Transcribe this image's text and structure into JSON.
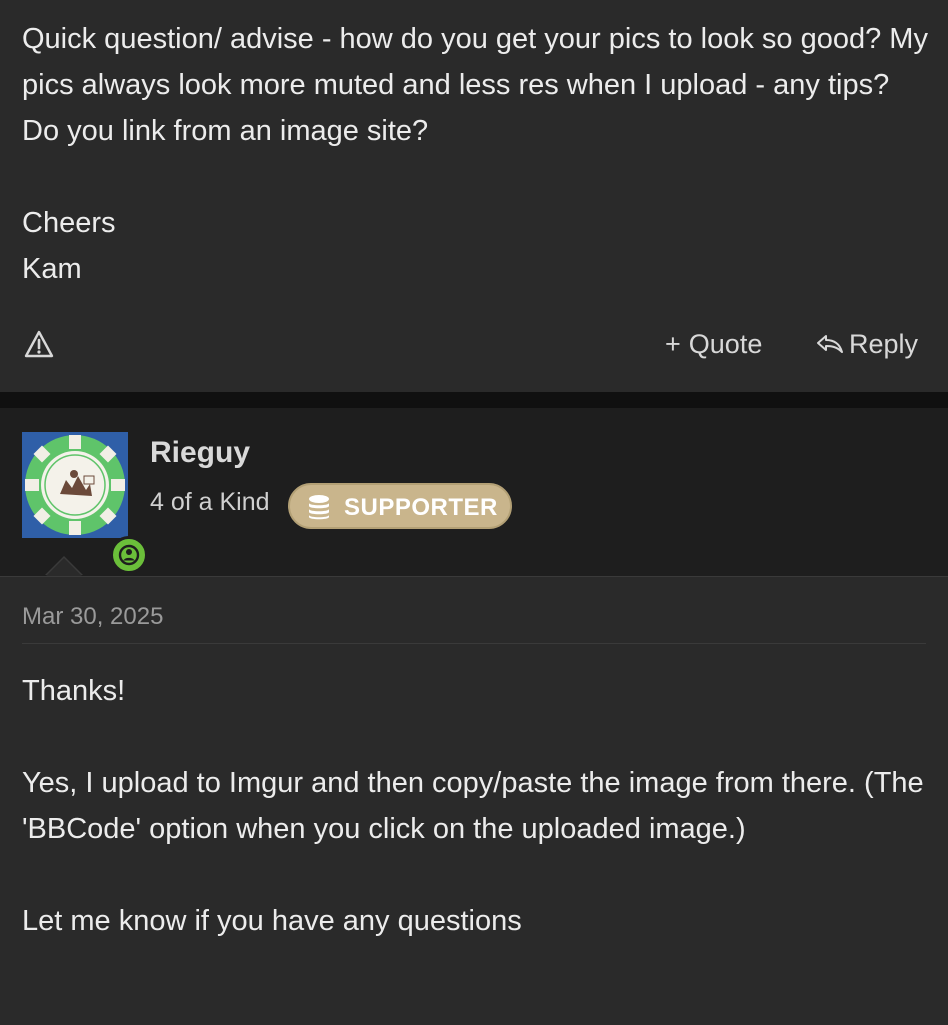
{
  "previous_post": {
    "body_lines": [
      "Quick question/ advise - how do you get your pics to look so good? My pics always look more muted and less res when I upload - any tips? Do you link from an image site?",
      "Cheers",
      "Kam"
    ],
    "actions": {
      "report_icon": "warning-triangle-icon",
      "quote_label": "Quote",
      "quote_glyph": "+",
      "reply_label": "Reply",
      "reply_icon": "reply-arrow-icon"
    }
  },
  "post": {
    "author": {
      "username": "Rieguy",
      "title": "4 of a Kind",
      "badge_label": "SUPPORTER",
      "badge_icon": "coin-stack-icon",
      "avatar_icon": "poker-chip-avatar",
      "online_icon": "online-user-icon"
    },
    "date": "Mar 30, 2025",
    "body": {
      "greeting": "Thanks!",
      "paragraph": "Yes, I upload to Imgur and then copy/paste the image from there. (The 'BBCode' option when you click on the uploaded image.)",
      "closing": "Let me know if you have any questions"
    }
  },
  "colors": {
    "background": "#2a2a2a",
    "header_background": "#1e1e1e",
    "badge": "#c9b58c",
    "online": "#6bbf3a",
    "text": "#ececec",
    "muted_text": "#9a9a9a"
  }
}
